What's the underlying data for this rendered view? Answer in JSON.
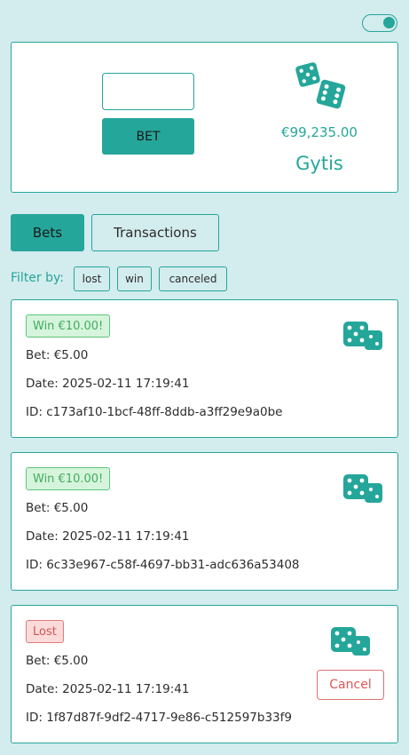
{
  "header": {
    "theme_toggle_on": true
  },
  "play": {
    "bet_input_value": "",
    "bet_button_label": "BET",
    "balance": "€99,235.00",
    "username": "Gytis"
  },
  "tabs": [
    {
      "label": "Bets",
      "active": true
    },
    {
      "label": "Transactions",
      "active": false
    }
  ],
  "filter": {
    "label": "Filter by:",
    "options": [
      "lost",
      "win",
      "canceled"
    ]
  },
  "bets": [
    {
      "status": "win",
      "badge": "Win  €10.00!",
      "bet": "Bet: €5.00",
      "date": "Date: 2025-02-11 17:19:41",
      "id": "ID: c173af10-1bcf-48ff-8ddb-a3ff29e9a0be"
    },
    {
      "status": "win",
      "badge": "Win  €10.00!",
      "bet": "Bet: €5.00",
      "date": "Date: 2025-02-11 17:19:41",
      "id": "ID: 6c33e967-c58f-4697-bb31-adc636a53408"
    },
    {
      "status": "lost",
      "badge": "Lost",
      "bet": "Bet: €5.00",
      "date": "Date: 2025-02-11 17:19:41",
      "id": "ID: 1f87d87f-9df2-4717-9e86-c512597b33f9",
      "cancel_label": "Cancel"
    }
  ],
  "icons": {
    "dice": "dice-icon",
    "toggle": "toggle-icon"
  },
  "colors": {
    "accent": "#25a69a",
    "background": "#d3ecee",
    "win": "#3fae5d",
    "lost": "#d05555"
  }
}
